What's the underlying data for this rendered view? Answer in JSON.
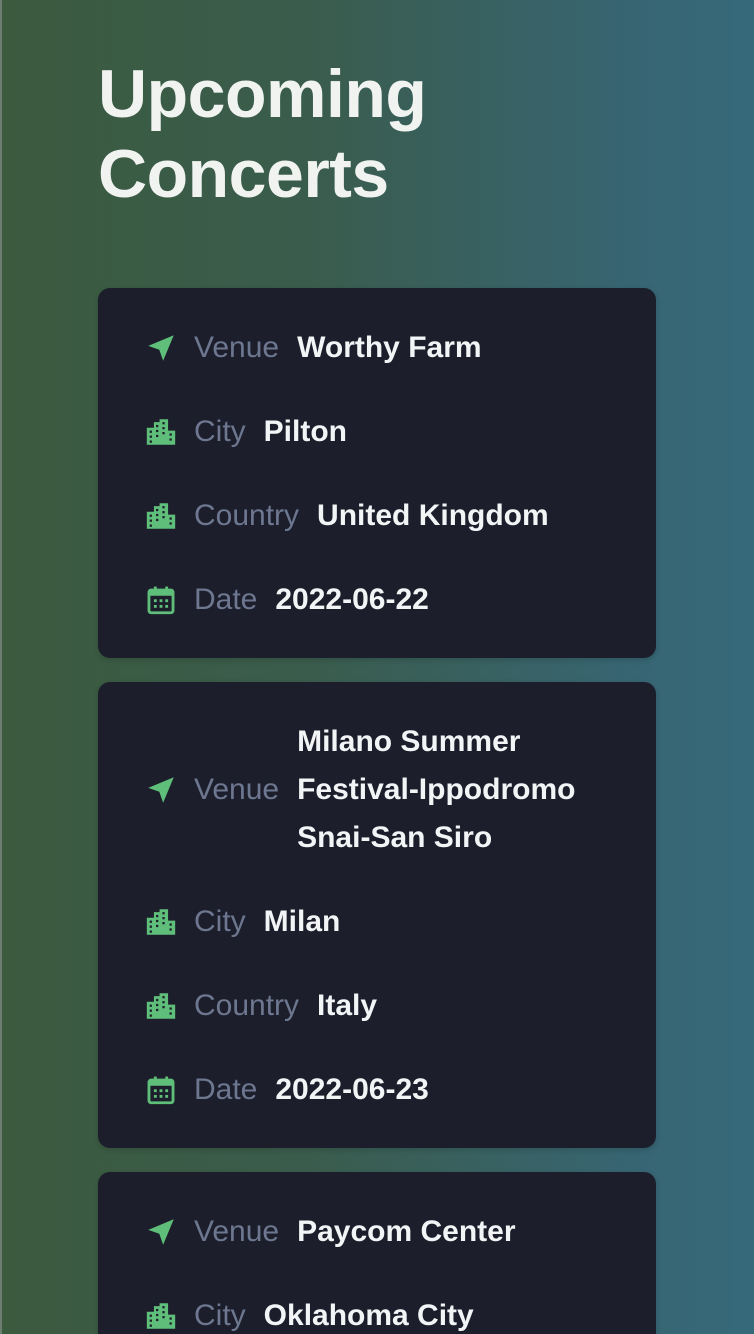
{
  "page_title": "Upcoming Concerts",
  "colors": {
    "accent_green": "#5fbf7a",
    "card_background": "#1c1f2b",
    "label_gray": "#6d7790",
    "value_white": "#f3f4f6"
  },
  "concerts": [
    {
      "venue_label": "Venue",
      "venue": "Worthy Farm",
      "city_label": "City",
      "city": "Pilton",
      "country_label": "Country",
      "country": "United Kingdom",
      "date_label": "Date",
      "date": "2022-06-22"
    },
    {
      "venue_label": "Venue",
      "venue": "Milano Summer Festival-Ippodromo Snai-San Siro",
      "city_label": "City",
      "city": "Milan",
      "country_label": "Country",
      "country": "Italy",
      "date_label": "Date",
      "date": "2022-06-23"
    },
    {
      "venue_label": "Venue",
      "venue": "Paycom Center",
      "city_label": "City",
      "city": "Oklahoma City"
    }
  ],
  "icons": {
    "venue": "location-arrow-icon",
    "city": "city-icon",
    "country": "city-icon",
    "date": "calendar-icon"
  }
}
